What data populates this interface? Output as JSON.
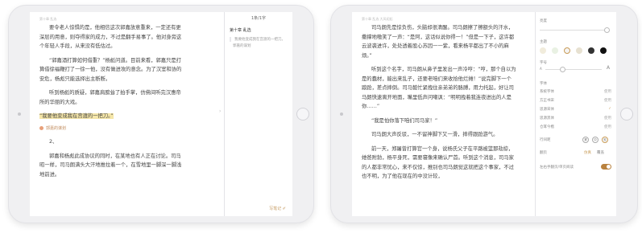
{
  "left_ipad": {
    "chapter_header": "第十章 乱选",
    "paragraphs": [
      "要令老人惊惧的是，他相信这次郭嘉放意重来，一定还有更深层的用意，则夺得家的成力，不过是翻手易事了。他对身旁这个年轻人手段，从来没有低估过。",
      "“郭嘉酒打算如何借重？”杨彪问道。目前来看，郭嘉只是打算借徐福鞭打了一徐一他，没有做进攻的意念。为了汉室和协的安危，杨彪只能选择出主断断。",
      "听到杨彪的质疑，郭嘉肩膀耸了拍手掌，仿佛间听完汉惠帝所的华丽的大戏。"
    ],
    "highlight": "“我要他变成我在宫渡的一把刀。”",
    "note_tag": "郭嘉的谋划",
    "numbered": "2、",
    "last_paragraph": "郭嘉和杨彪此成协议的同时，在某地也有人正在讨论。司马昭一样，司马朗满头大汗地推拉着一个，在雪地里一脚深一脚浅地前进。",
    "note_panel": {
      "count": "1条/1字",
      "chapter": "第十章 乱选",
      "quote": "我要他变成我在宫渡的一把刀。",
      "excerpt": "郭嘉的谋划",
      "footer": "写笔记 ✐",
      "arrow": "›"
    }
  },
  "right_ipad": {
    "chapter_header": "第十章 乱选  大风初起",
    "paragraphs": [
      "司马朗先是惊负伤，头脑却很清醒。司马朗擦了擦额头的汗水，撒撑地嗷笑了一声：“是阿，这话似说你得一！”但是一下子，这许都云波袭进许，处处透着股心苏因一一紫，看来杨平都出了不小的麻烦。”",
      "听到这个名字，司马朗从鼻子里发出一声冷哼：“哼，那个自以为是的蠢材，能出来乱子，还要老咱们来收拾他烂摊！”说完脚下一个踉跄，差点摔倒。司马懿忙紧拽住亲弟弟的胳膊，用力托起，好让司马朗快速离开地面，嘴里低声问嘲讽：“明明拽着我连夜进出的人是你……”",
      "“我是怕你落下咱们司马家！”",
      "司马朗大声反驳，一不留神脚下又一滑，摔得跟跄游气。",
      "前一天，郑屠曾打算官一个身，说杨氏父子在平路被篮那劫掠，她爸附勃，杨平身死，需要寝像来确认尸首。听到这个消息，司马家的人都非常忧心，来不仅惊，推别也司马朗觉这就把这个事家，不过也不明，为了他在现在的中没计较，"
    ],
    "settings": {
      "brightness_label": "亮度",
      "theme_label": "主题",
      "swatch_colors": [
        "#f1ecdc",
        "#e9f1e3",
        "#f4f4f4",
        "#e7e1d1",
        "#333333",
        "#111111"
      ],
      "fontsize_label": "字号",
      "font_small": "A",
      "font_large": "A",
      "font_label": "字体",
      "fonts": [
        {
          "name": "系统字体",
          "status": "使用"
        },
        {
          "name": "方正书宋",
          "status": "使用"
        },
        {
          "name": "思源宋体",
          "status": "✓"
        },
        {
          "name": "思源黑体",
          "status": "使用"
        },
        {
          "name": "仓耳今楷",
          "status": "使用"
        }
      ],
      "spacing_label": "行间距",
      "spacing_opts": [
        "紧",
        "中",
        "松"
      ],
      "margin_label": "翻页",
      "margin_opts": [
        "仿真",
        "覆盖"
      ],
      "toggle_label": "左右手翻页/单页阅读"
    }
  }
}
